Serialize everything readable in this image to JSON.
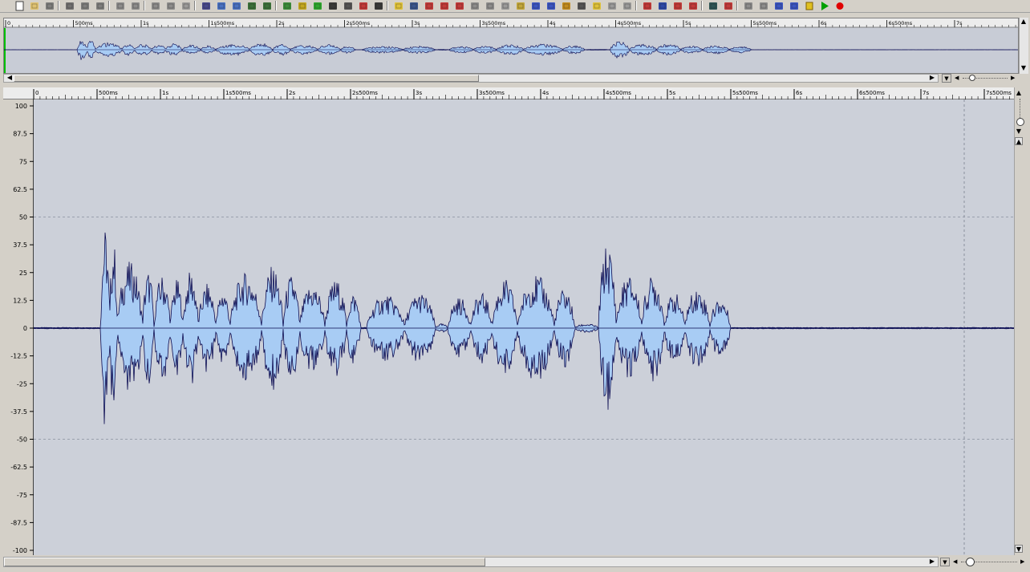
{
  "toolbar": {
    "icons": [
      "new-icon",
      "open-icon",
      "save-icon",
      "cut-icon",
      "copy-icon",
      "paste-icon",
      "undo-icon",
      "redo-icon",
      "delete-icon",
      "erase-icon",
      "volume-icon",
      "split-icon",
      "view-single-icon",
      "view-double-icon",
      "snap-icon",
      "grid-icon",
      "spectrum-icon",
      "fx1-icon",
      "fx2-icon",
      "fx3-icon",
      "fx4-icon",
      "fx5-icon",
      "fx6-icon",
      "marker-tool-icon",
      "scrub-tool-icon",
      "cut-tool-icon",
      "pause-marker-icon",
      "loop-marker-icon",
      "delete-marker-icon",
      "link-icon",
      "copy-region-icon",
      "pencil-tool-icon",
      "cursor-tool-icon",
      "color-tool-icon",
      "speaker-tool-icon",
      "zoom-tool-icon",
      "draw-tool-icon",
      "smooth-tool-icon",
      "bend-tool-icon",
      "arrow-marker-1-icon",
      "arrow-marker-2-icon",
      "arrow-marker-3-icon",
      "arrow-marker-4-icon",
      "loop-play-icon",
      "stop-marker-icon",
      "go-start-icon",
      "rewind-icon",
      "fast-forward-icon",
      "go-end-icon",
      "stop-icon",
      "play-icon",
      "record-icon"
    ]
  },
  "overview": {
    "ticks": [
      "0",
      "500ms",
      "1s",
      "1s500ms",
      "2s",
      "2s500ms",
      "3s",
      "3s500ms",
      "4s",
      "4s500ms",
      "5s",
      "5s500ms",
      "6s",
      "6s500ms",
      "7s"
    ]
  },
  "ruler": {
    "ticks": [
      "0",
      "500ms",
      "1s",
      "1s500ms",
      "2s",
      "2s500ms",
      "3s",
      "3s500ms",
      "4s",
      "4s500ms",
      "5s",
      "5s500ms",
      "6s",
      "6s500ms",
      "7s",
      "7s500ms"
    ]
  },
  "yaxis": {
    "labels": [
      "100",
      "87.5",
      "75",
      "62.5",
      "50",
      "37.5",
      "25",
      "12.5",
      "0",
      "-12.5",
      "-25",
      "-37.5",
      "-50",
      "-62.5",
      "-75",
      "-87.5",
      "-100"
    ]
  },
  "colors": {
    "waveform_fill": "#a8ccf4",
    "waveform_stroke": "#0a0a50",
    "plot_bg": "#ccd0d9",
    "play_green": "#00a000",
    "record_red": "#e00000"
  }
}
